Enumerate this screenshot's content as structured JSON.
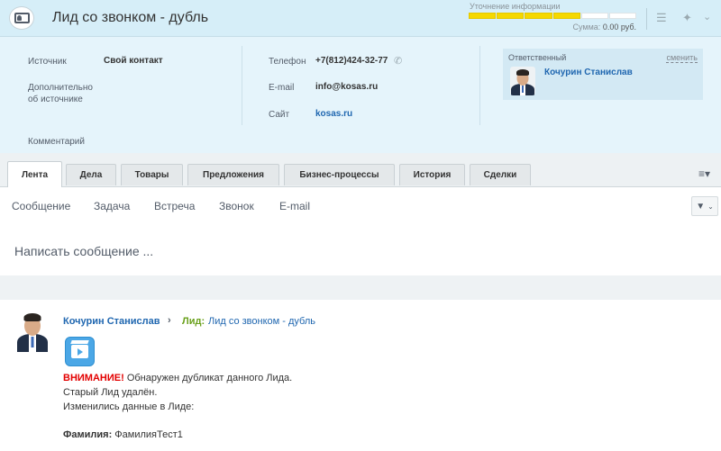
{
  "header": {
    "title": "Лид со звонком - дубль",
    "progress_label": "Уточнение информации",
    "progress_filled": 4,
    "progress_total": 6,
    "sum_label": "Сумма:",
    "sum_value": "0.00 руб."
  },
  "info": {
    "source_label": "Источник",
    "source_value": "Свой контакт",
    "source_extra_label_1": "Дополнительно",
    "source_extra_label_2": "об источнике",
    "comment_label": "Комментарий",
    "phone_label": "Телефон",
    "phone_value": "+7(812)424-32-77",
    "email_label": "E-mail",
    "email_value": "info@kosas.ru",
    "site_label": "Сайт",
    "site_value": "kosas.ru",
    "responsible_label": "Ответственный",
    "responsible_change": "сменить",
    "responsible_name": "Кочурин Станислав"
  },
  "tabs": [
    {
      "label": "Лента"
    },
    {
      "label": "Дела"
    },
    {
      "label": "Товары"
    },
    {
      "label": "Предложения"
    },
    {
      "label": "Бизнес-процессы"
    },
    {
      "label": "История"
    },
    {
      "label": "Сделки"
    }
  ],
  "activity": {
    "types": [
      {
        "label": "Сообщение"
      },
      {
        "label": "Задача"
      },
      {
        "label": "Встреча"
      },
      {
        "label": "Звонок"
      },
      {
        "label": "E-mail"
      }
    ],
    "write_placeholder": "Написать сообщение ..."
  },
  "feed": {
    "author": "Кочурин Станислав",
    "entity_type": "Лид:",
    "entity_name": "Лид со звонком - дубль",
    "warning": "ВНИМАНИЕ!",
    "line1_rest": " Обнаружен дубликат данного Лида.",
    "line2": "Старый Лид удалён.",
    "line3": "Изменились данные в Лиде:",
    "field_label": "Фамилия:",
    "field_value": " ФамилияТест1"
  },
  "colors": {
    "accent_link": "#2067b0",
    "progress_fill": "#f5d800",
    "warning_red": "#e30000",
    "entity_green": "#6aa11c"
  }
}
